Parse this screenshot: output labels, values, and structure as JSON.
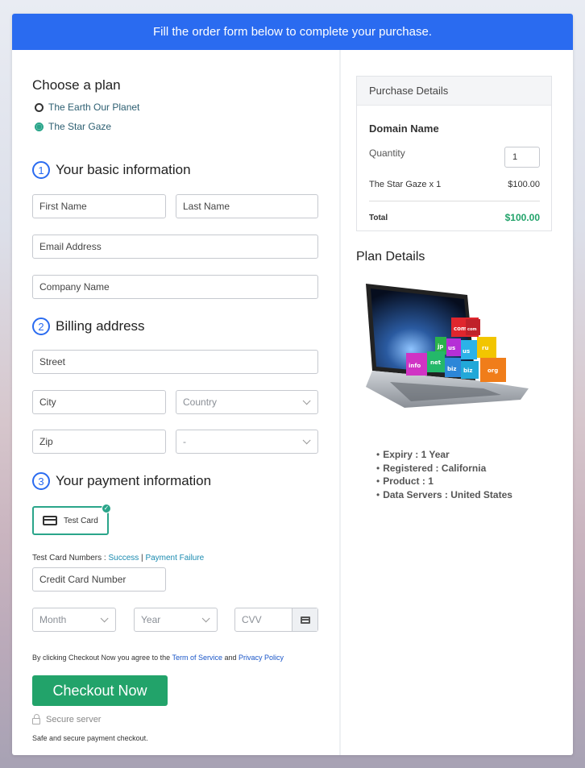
{
  "banner": {
    "text": "Fill the order form below to complete your purchase."
  },
  "plan": {
    "heading": "Choose a plan",
    "options": [
      {
        "label": "The Earth Our Planet",
        "selected": false
      },
      {
        "label": "The Star Gaze",
        "selected": true
      }
    ]
  },
  "sections": {
    "basic": {
      "number": "1",
      "title": "Your basic information"
    },
    "billing": {
      "number": "2",
      "title": "Billing address"
    },
    "payment": {
      "number": "3",
      "title": "Your payment information"
    }
  },
  "fields": {
    "first_name": "First Name",
    "last_name": "Last Name",
    "email": "Email Address",
    "company": "Company Name",
    "street": "Street",
    "city": "City",
    "country": "Country",
    "zip": "Zip",
    "state": "-",
    "card_number": "Credit Card Number",
    "month": "Month",
    "year": "Year",
    "cvv": "CVV"
  },
  "payment": {
    "method_label": "Test Card",
    "test_numbers_label": "Test Card Numbers : ",
    "success_link": "Success",
    "separator": " | ",
    "failure_link": "Payment Failure"
  },
  "terms": {
    "prefix": "By clicking Checkout Now you agree to the ",
    "terms_link": "Term of Service",
    "and": " and ",
    "privacy_link": "Privacy Policy"
  },
  "checkout": {
    "button": "Checkout Now",
    "secure": "Secure server",
    "note": "Safe and secure payment checkout."
  },
  "purchase": {
    "heading": "Purchase Details",
    "product": "Domain Name",
    "quantity_label": "Quantity",
    "quantity_value": "1",
    "line_item": "The Star Gaze x 1",
    "line_price": "$100.00",
    "total_label": "Total",
    "total_value": "$100.00"
  },
  "plan_details": {
    "heading": "Plan Details",
    "image_tags": [
      "com",
      "com",
      "jp",
      "us",
      "ru",
      "us",
      "info",
      "net",
      "biz",
      "biz",
      "org"
    ],
    "items": [
      {
        "key": "Expiry :",
        "value": "1 Year"
      },
      {
        "key": "Registered :",
        "value": "California"
      },
      {
        "key": "Product :",
        "value": "1"
      },
      {
        "key": "Data Servers :",
        "value": "United States"
      }
    ]
  },
  "colors": {
    "accent_blue": "#2a6bf0",
    "success_green": "#22a36a",
    "teal": "#2aa58a"
  }
}
